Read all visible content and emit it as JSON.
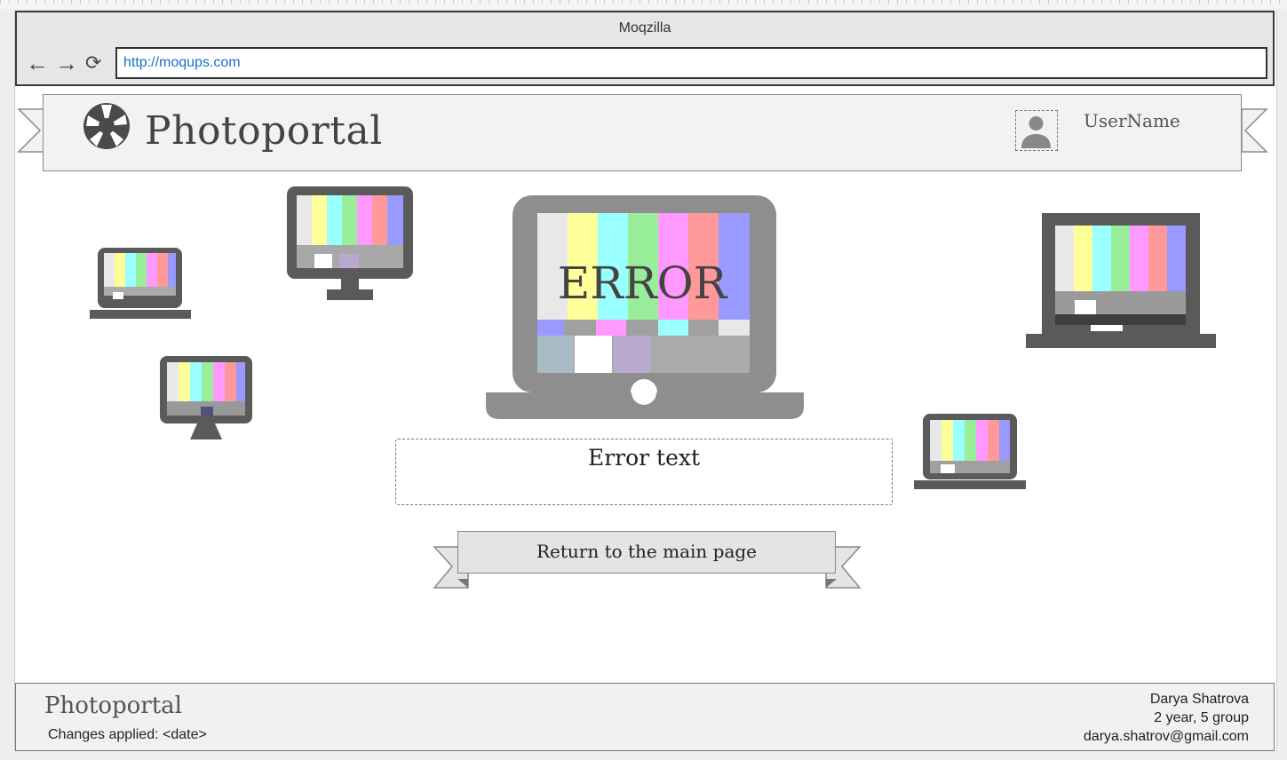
{
  "browser": {
    "title": "Moqzilla",
    "url": "http://moqups.com",
    "back_icon": "arrow-left-icon",
    "forward_icon": "arrow-right-icon",
    "reload_icon": "reload-icon"
  },
  "header": {
    "site_name": "Photoportal",
    "logo_icon": "camera-aperture-icon",
    "avatar_icon": "user-avatar-icon",
    "username": "UserName"
  },
  "main": {
    "error_label": "ERROR",
    "error_text": "Error text",
    "return_button": "Return to the main page"
  },
  "footer": {
    "site_name": "Photoportal",
    "changes": "Changes applied: <date>",
    "author_name": "Darya Shatrova",
    "author_group": "2 year, 5 group",
    "author_email": "darya.shatrov@gmail.com"
  },
  "colors": {
    "device_dark": "#5a5a5a",
    "device_gray": "#8e8e8e",
    "link_blue": "#1a6fd0",
    "bar_colors": [
      "#e8e8e8",
      "#ffff99",
      "#99ffff",
      "#99ee99",
      "#ff99ff",
      "#ff9999",
      "#9999ff"
    ]
  }
}
